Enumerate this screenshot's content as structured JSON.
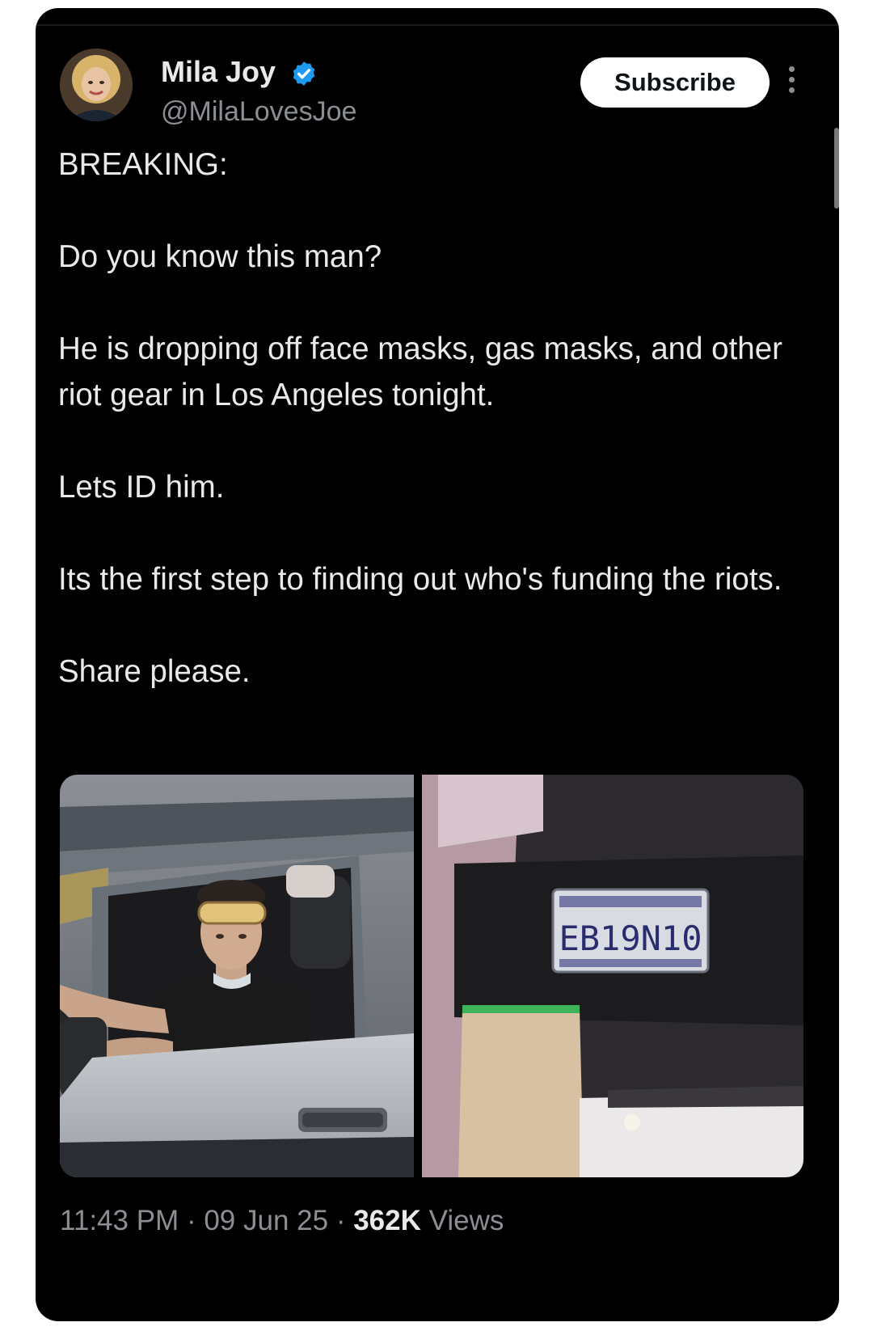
{
  "tweet": {
    "author": {
      "display_name": "Mila Joy",
      "handle": "@MilaLovesJoe",
      "verified": true
    },
    "subscribe_label": "Subscribe",
    "paragraphs": [
      "BREAKING:",
      "Do you know this man?",
      "He is dropping off face masks, gas masks, and other riot gear in Los Angeles tonight.",
      "Lets ID him.",
      "Its the first step to finding out who's funding the riots.",
      "Share please."
    ],
    "media": [
      {
        "icon": "photo-driver-in-truck"
      },
      {
        "icon": "photo-license-plate",
        "plate_text": "EB19N10"
      }
    ],
    "time": "11:43 PM",
    "date": "09 Jun 25",
    "separator": "·",
    "views_count": "362K",
    "views_label": "Views"
  },
  "colors": {
    "background": "#000000",
    "text": "#e7e9ea",
    "muted": "#8b8f94",
    "verified": "#1d9bf0",
    "subscribe_bg": "#ffffff"
  }
}
